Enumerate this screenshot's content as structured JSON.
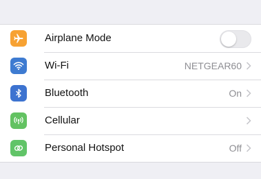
{
  "settings": {
    "items": [
      {
        "label": "Airplane Mode",
        "icon": "airplane-icon",
        "color": "#f7a233",
        "toggle_on": false
      },
      {
        "label": "Wi-Fi",
        "icon": "wifi-icon",
        "color": "#3e7bd1",
        "value": "NETGEAR60"
      },
      {
        "label": "Bluetooth",
        "icon": "bluetooth-icon",
        "color": "#3d73d0",
        "value": "On"
      },
      {
        "label": "Cellular",
        "icon": "cellular-antenna-icon",
        "color": "#63c262",
        "value": ""
      },
      {
        "label": "Personal Hotspot",
        "icon": "hotspot-link-icon",
        "color": "#61c468",
        "value": "Off"
      }
    ]
  }
}
